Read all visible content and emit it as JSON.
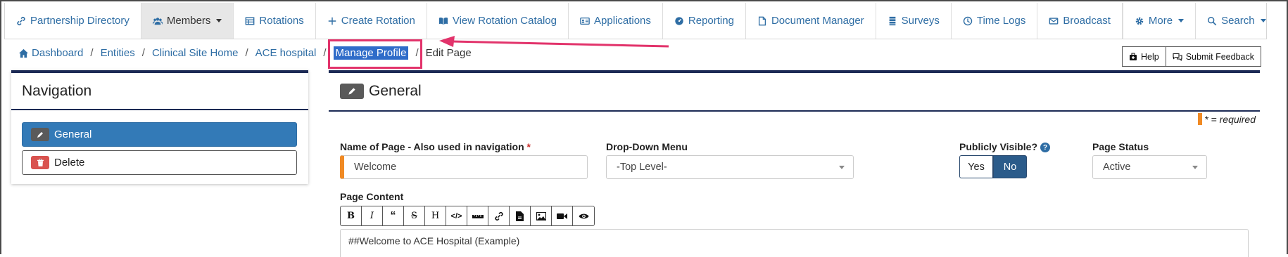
{
  "topnav": {
    "items": [
      {
        "label": "Partnership Directory",
        "icon": "link-icon"
      },
      {
        "label": "Members",
        "icon": "users-icon"
      },
      {
        "label": "Rotations",
        "icon": "table-icon"
      },
      {
        "label": "Create Rotation",
        "icon": "plus-icon"
      },
      {
        "label": "View Rotation Catalog",
        "icon": "book-icon"
      },
      {
        "label": "Applications",
        "icon": "id-card-icon"
      },
      {
        "label": "Reporting",
        "icon": "dashboard-icon"
      },
      {
        "label": "Document Manager",
        "icon": "file-icon"
      },
      {
        "label": "Surveys",
        "icon": "list-icon"
      },
      {
        "label": "Time Logs",
        "icon": "clock-icon"
      },
      {
        "label": "Broadcast",
        "icon": "envelope-icon"
      }
    ],
    "more": "More",
    "search": "Search"
  },
  "breadcrumb": {
    "items": [
      "Dashboard",
      "Entities",
      "Clinical Site Home",
      "ACE hospital",
      "Manage Profile"
    ],
    "current": "Edit Page",
    "sep": "/"
  },
  "tools": {
    "help": "Help",
    "feedback": "Submit Feedback"
  },
  "navigation": {
    "title": "Navigation",
    "items": [
      {
        "label": "General"
      },
      {
        "label": "Delete"
      }
    ]
  },
  "general": {
    "title": "General",
    "required_note": "* = required",
    "name_label": "Name of Page - Also used in navigation",
    "name_value": "Welcome",
    "dropdown_label": "Drop-Down Menu",
    "dropdown_value": "-Top Level-",
    "visible_label": "Publicly Visible?",
    "visible_yes": "Yes",
    "visible_no": "No",
    "visible_selected": "No",
    "status_label": "Page Status",
    "status_value": "Active",
    "content_label": "Page Content",
    "content_value": "##Welcome to ACE Hospital (Example)"
  },
  "colors": {
    "accent": "#2e6da4",
    "highlight": "#e2336b",
    "required": "#f08a24",
    "panel_border": "#1c2a55"
  }
}
